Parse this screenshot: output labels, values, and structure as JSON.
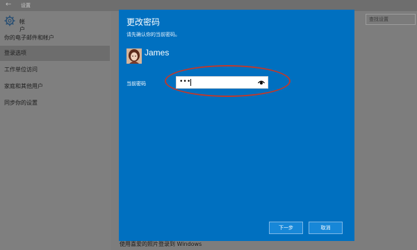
{
  "window": {
    "title": "设置",
    "back_label": "←"
  },
  "sidebar": {
    "title": "帐户",
    "items": [
      {
        "label": "你的电子邮件和帐户"
      },
      {
        "label": "登录选项"
      },
      {
        "label": "工作单位访问"
      },
      {
        "label": "家庭和其他用户"
      },
      {
        "label": "同步你的设置"
      }
    ],
    "selected_index": 1
  },
  "search": {
    "placeholder": "查找设置"
  },
  "main": {
    "bottom_text": "使用喜爱的照片登录到 Windows"
  },
  "dialog": {
    "title": "更改密码",
    "subtitle": "请先确认你的当前密码。",
    "user_name": "James",
    "password_label": "当前密码",
    "password_value": "•••",
    "next_label": "下一步",
    "cancel_label": "取消"
  },
  "colors": {
    "dialog_bg": "#0070c0",
    "highlight_oval": "#c0392b",
    "button_bg": "#1787d8"
  },
  "icons": {
    "settings": "gear-icon",
    "reveal": "eye-icon"
  }
}
